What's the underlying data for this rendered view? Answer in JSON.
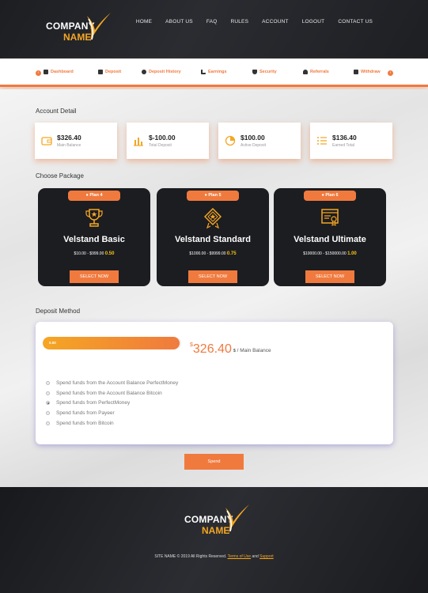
{
  "brand": {
    "company": "COMPANY",
    "name": "NAME",
    "accent": "#f07a3e",
    "accent_yellow": "#f5a623",
    "dark": "#1c1d21"
  },
  "nav": {
    "items": [
      "HOME",
      "ABOUT US",
      "FAQ",
      "RULES",
      "ACCOUNT",
      "LOGOUT",
      "CONTACT US"
    ]
  },
  "subnav": {
    "items": [
      {
        "label": "Dashboard",
        "icon": "dashboard-icon"
      },
      {
        "label": "Deposit",
        "icon": "deposit-icon"
      },
      {
        "label": "Deposit History",
        "icon": "history-icon"
      },
      {
        "label": "Earnings",
        "icon": "earnings-icon"
      },
      {
        "label": "Security",
        "icon": "shield-icon"
      },
      {
        "label": "Referrals",
        "icon": "users-icon"
      },
      {
        "label": "Withdraw",
        "icon": "wallet-icon"
      }
    ]
  },
  "account": {
    "title": "Account Detail",
    "cards": [
      {
        "value": "$326.40",
        "label": "Main Balance",
        "icon": "wallet-icon"
      },
      {
        "value": "$-100.00",
        "label": "Total Deposit",
        "icon": "bar-chart-icon"
      },
      {
        "value": "$100.00",
        "label": "Active Deposit",
        "icon": "pie-chart-icon"
      },
      {
        "value": "$136.40",
        "label": "Earned Total",
        "icon": "list-icon"
      }
    ]
  },
  "packages": {
    "title": "Choose Package",
    "items": [
      {
        "badge": "Plan 4",
        "name": "Velstand Basic",
        "range": "$10.00 - $999.00",
        "rate": "0.50",
        "button": "SELECT NOW",
        "icon": "trophy-icon"
      },
      {
        "badge": "Plan 5",
        "name": "Velstand Standard",
        "range": "$1000.00 - $9999.00",
        "rate": "0.75",
        "button": "SELECT NOW",
        "icon": "badge-star-icon"
      },
      {
        "badge": "Plan 6",
        "name": "Velstand Ultimate",
        "range": "$10000.00 - $150000.00",
        "rate": "1.00",
        "button": "SELECT NOW",
        "icon": "certificate-icon"
      }
    ]
  },
  "deposit": {
    "title": "Deposit Method",
    "progress_label": "0.00",
    "progress_fraction": 0.986,
    "amount": "326.40",
    "currency_symbol": "$",
    "unit_symbol": "$",
    "unit_label": "/ Main Balance",
    "options": [
      {
        "label": "Spend funds from the Account Balance PerfectMoney",
        "selected": false
      },
      {
        "label": "Spend funds from the Account Balance Bitcoin",
        "selected": false
      },
      {
        "label": "Spend funds from PerfectMoney",
        "selected": true
      },
      {
        "label": "Spend funds from Payeer",
        "selected": false
      },
      {
        "label": "Spend funds from Bitcoin",
        "selected": false
      }
    ],
    "button": "Spend"
  },
  "footer": {
    "text_before": "SITE NAME © 2019 All Rights Reserved.",
    "terms": "Terms of Use",
    "and": "and",
    "support": "Support"
  }
}
